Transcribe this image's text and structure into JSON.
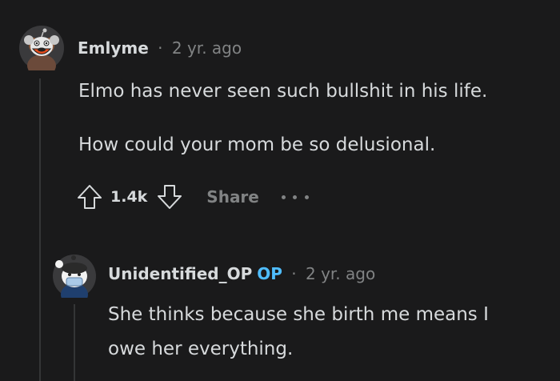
{
  "comment": {
    "username": "Emlyme",
    "separator": "·",
    "time": "2 yr. ago",
    "paragraphs": [
      "Elmo has never seen such bullshit in his life.",
      "How could your mom be so delusional."
    ],
    "votes": "1.4k",
    "share_label": "Share",
    "icons": {
      "avatar": "avatar-icon",
      "upvote": "upvote-icon",
      "downvote": "downvote-icon",
      "more": "more-options-icon"
    }
  },
  "reply": {
    "username": "Unidentified_OP",
    "op_badge": "OP",
    "separator": "·",
    "time": "2 yr. ago",
    "lines": [
      "She thinks because she birth me means I",
      "owe her everything."
    ]
  },
  "colors": {
    "background": "#1a1a1b",
    "text": "#d7dadc",
    "muted": "#818384",
    "op_blue": "#4fbdff",
    "thread_line": "#343536"
  }
}
